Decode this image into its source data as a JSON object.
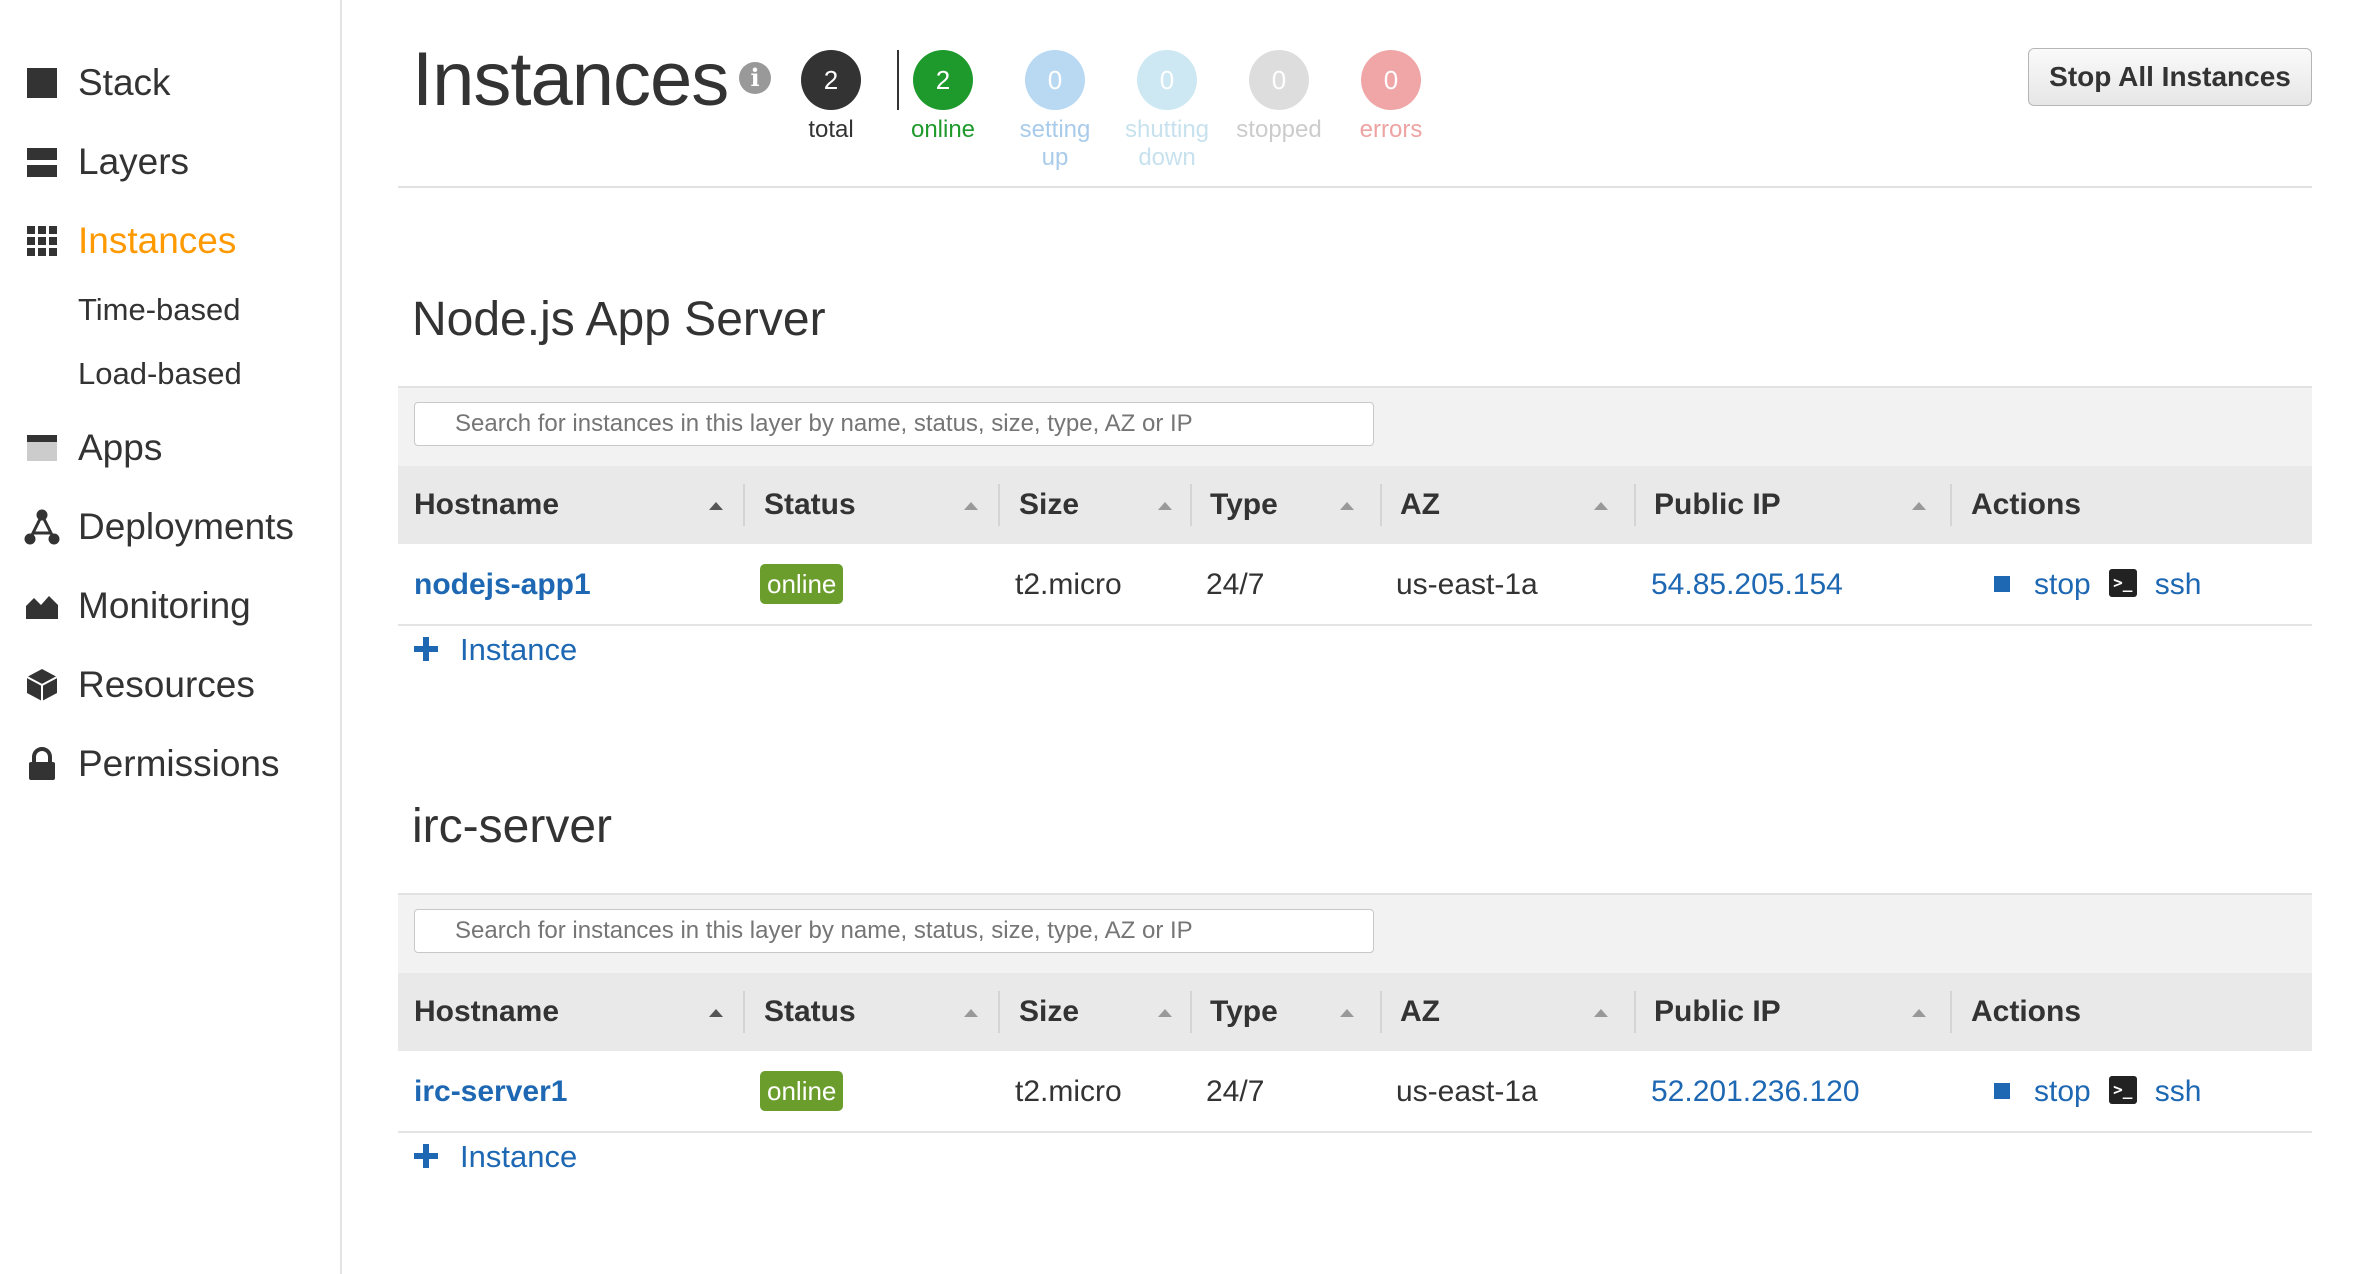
{
  "sidebar": {
    "items": [
      {
        "label": "Stack",
        "icon": "stack-icon"
      },
      {
        "label": "Layers",
        "icon": "layers-icon"
      },
      {
        "label": "Instances",
        "icon": "grid-icon",
        "active": true
      },
      {
        "label": "Apps",
        "icon": "apps-icon"
      },
      {
        "label": "Deployments",
        "icon": "deployments-icon"
      },
      {
        "label": "Monitoring",
        "icon": "monitoring-icon"
      },
      {
        "label": "Resources",
        "icon": "cube-icon"
      },
      {
        "label": "Permissions",
        "icon": "lock-icon"
      }
    ],
    "subitems": [
      "Time-based",
      "Load-based"
    ]
  },
  "header": {
    "title": "Instances",
    "info_icon": "i",
    "stats": [
      {
        "count": "2",
        "label": "total",
        "color": "#333333",
        "label_color": "#333333"
      },
      {
        "count": "2",
        "label": "online",
        "color": "#1e9a2d",
        "label_color": "#1e9a2d"
      },
      {
        "count": "0",
        "label": "setting up",
        "color": "#b9d8f2",
        "label_color": "#a9cbea"
      },
      {
        "count": "0",
        "label": "shutting down",
        "color": "#cde8f3",
        "label_color": "#c7e2ee"
      },
      {
        "count": "0",
        "label": "stopped",
        "color": "#dddddd",
        "label_color": "#cccccc"
      },
      {
        "count": "0",
        "label": "errors",
        "color": "#f0a6a6",
        "label_color": "#eea3a3"
      }
    ],
    "stop_all_label": "Stop All Instances"
  },
  "columns": [
    "Hostname",
    "Status",
    "Size",
    "Type",
    "AZ",
    "Public IP",
    "Actions"
  ],
  "search_placeholder": "Search for instances in this layer by name, status, size, type, AZ or IP",
  "layers": [
    {
      "title": "Node.js App Server",
      "rows": [
        {
          "hostname": "nodejs-app1",
          "status": "online",
          "size": "t2.micro",
          "type": "24/7",
          "az": "us-east-1a",
          "public_ip": "54.85.205.154",
          "stop": "stop",
          "ssh": "ssh"
        }
      ],
      "add_label": "Instance"
    },
    {
      "title": "irc-server",
      "rows": [
        {
          "hostname": "irc-server1",
          "status": "online",
          "size": "t2.micro",
          "type": "24/7",
          "az": "us-east-1a",
          "public_ip": "52.201.236.120",
          "stop": "stop",
          "ssh": "ssh"
        }
      ],
      "add_label": "Instance"
    }
  ],
  "colors": {
    "accent": "#ff9900",
    "link": "#1e68b3",
    "online_badge": "#6a9d2c"
  }
}
